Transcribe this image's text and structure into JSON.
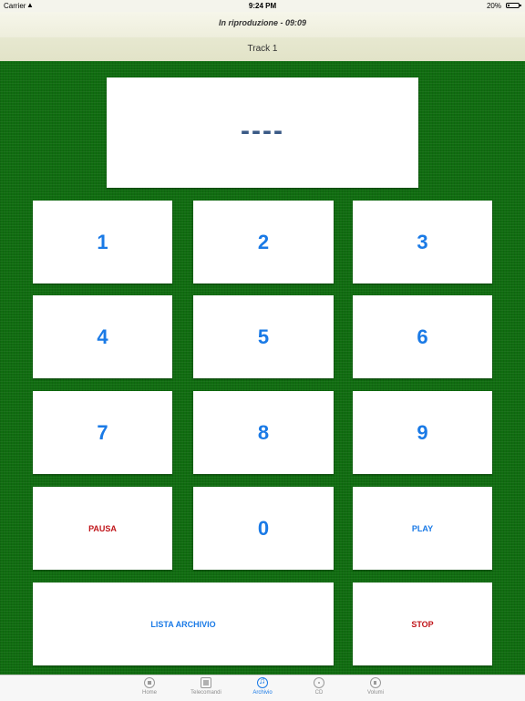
{
  "status_bar": {
    "carrier": "Carrier",
    "time": "9:24 PM",
    "battery": "20%",
    "battery_level": 0.2
  },
  "nav": {
    "title": "In riproduzione - 09:09"
  },
  "track": {
    "label": "Track 1"
  },
  "display": {
    "value": "----"
  },
  "keys": {
    "k1": "1",
    "k2": "2",
    "k3": "3",
    "k4": "4",
    "k5": "5",
    "k6": "6",
    "k7": "7",
    "k8": "8",
    "k9": "9",
    "pause": "PAUSA",
    "k0": "0",
    "play": "PLAY",
    "list": "LISTA ARCHIVIO",
    "stop": "STOP"
  },
  "tabs": [
    {
      "label": "Home",
      "icon": "home-icon"
    },
    {
      "label": "Telecomandi",
      "icon": "remote-icon"
    },
    {
      "label": "Archivio",
      "icon": "music-icon",
      "active": true
    },
    {
      "label": "CD",
      "icon": "cd-icon"
    },
    {
      "label": "Volumi",
      "icon": "volume-icon"
    }
  ],
  "colors": {
    "background": "#106d10",
    "accent": "#1a7ae6",
    "danger": "#c0151a"
  }
}
